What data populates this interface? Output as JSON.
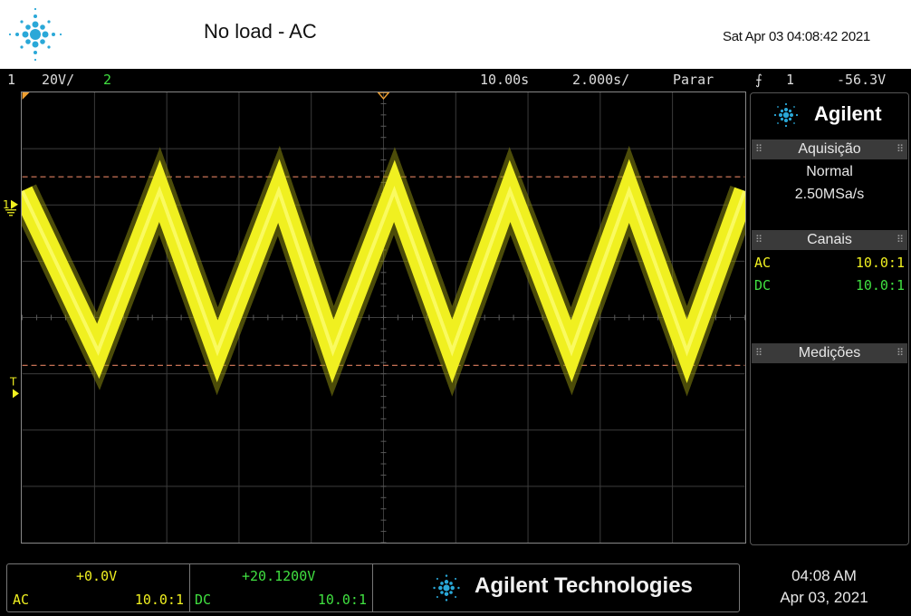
{
  "header": {
    "title": "No load - AC",
    "timestamp": "Sat Apr 03 04:08:42 2021"
  },
  "status_bar": {
    "ch1_number": "1",
    "ch1_scale": "20V/",
    "ch2_number": "2",
    "time_delay": "10.00s",
    "time_scale": "2.000s/",
    "run_state": "Parar",
    "trigger_slope": "⨍",
    "trigger_source": "1",
    "trigger_level": "-56.3V"
  },
  "sidebar": {
    "brand": "Agilent",
    "acquisition": {
      "header": "Aquisição",
      "mode": "Normal",
      "rate": "2.50MSa/s"
    },
    "channels": {
      "header": "Canais",
      "rows": [
        {
          "coupling": "AC",
          "probe": "10.0:1",
          "color": "#f0f020"
        },
        {
          "coupling": "DC",
          "probe": "10.0:1",
          "color": "#40e040"
        }
      ]
    },
    "measurements": {
      "header": "Medições"
    }
  },
  "bottom_panel": {
    "ch1": {
      "offset": "+0.0V",
      "coupling": "AC",
      "probe": "10.0:1"
    },
    "ch2": {
      "offset": "+20.1200V",
      "coupling": "DC",
      "probe": "10.0:1"
    },
    "brand": "Agilent Technologies"
  },
  "clock": {
    "time": "04:08 AM",
    "date": "Apr 03, 2021"
  },
  "colors": {
    "ch1": "#f0f020",
    "ch2": "#40e040",
    "cursor": "#e08060",
    "trigger_marker": "#f0a030",
    "brand_blue": "#2aa8d8"
  },
  "waveform": {
    "peaks": [
      0.0,
      1.9,
      3.55,
      5.15,
      6.75,
      8.4,
      10.0
    ],
    "troughs": [
      1.05,
      2.7,
      4.3,
      5.95,
      7.6,
      9.2
    ],
    "peak_level_div": 2.25,
    "trough_level_div": -0.6,
    "cursor_high_div": 2.5,
    "cursor_low_div": -0.85,
    "ch1_marker_div": 2.0
  }
}
